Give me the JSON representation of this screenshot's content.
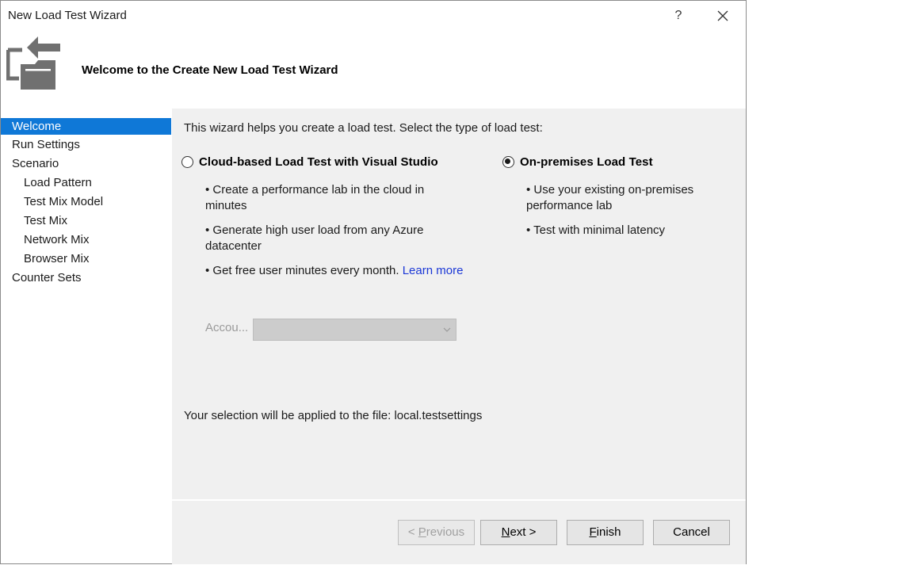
{
  "window": {
    "title": "New Load Test Wizard",
    "help_label": "?"
  },
  "header": {
    "title": "Welcome to the Create New Load Test Wizard",
    "icon": "wizard-icon"
  },
  "nav": {
    "items": [
      {
        "label": "Welcome",
        "level": 0,
        "selected": true
      },
      {
        "label": "Run Settings",
        "level": 0,
        "selected": false
      },
      {
        "label": "Scenario",
        "level": 0,
        "selected": false
      },
      {
        "label": "Load Pattern",
        "level": 1,
        "selected": false
      },
      {
        "label": "Test Mix Model",
        "level": 1,
        "selected": false
      },
      {
        "label": "Test Mix",
        "level": 1,
        "selected": false
      },
      {
        "label": "Network Mix",
        "level": 1,
        "selected": false
      },
      {
        "label": "Browser Mix",
        "level": 1,
        "selected": false
      },
      {
        "label": "Counter Sets",
        "level": 0,
        "selected": false
      }
    ]
  },
  "content": {
    "intro": "This wizard helps you create a load test. Select the type of load test:",
    "cloud": {
      "label": "Cloud-based Load Test with Visual Studio",
      "checked": false,
      "bullet1": "• Create a performance lab in the cloud in minutes",
      "bullet2": "• Generate high user load from any Azure datacenter",
      "bullet3": "• Get free user minutes every month.",
      "learn_more": "Learn more"
    },
    "onprem": {
      "label": "On-premises Load Test",
      "checked": true,
      "bullet1": "• Use your existing on-premises performance lab",
      "bullet2": "• Test with minimal latency"
    },
    "account_label": "Accou...",
    "account_value": "",
    "apply_text": "Your selection will be applied to the file: local.testsettings"
  },
  "footer": {
    "previous_mn": "P",
    "previous_rest": "revious",
    "previous_prefix": "< ",
    "next_mn": "N",
    "next_rest": "ext >",
    "finish_mn": "F",
    "finish_rest": "inish",
    "cancel": "Cancel"
  },
  "colors": {
    "selected_bg": "#0f78d7",
    "panel_bg": "#f0f0f0",
    "link": "#1a37d6"
  }
}
